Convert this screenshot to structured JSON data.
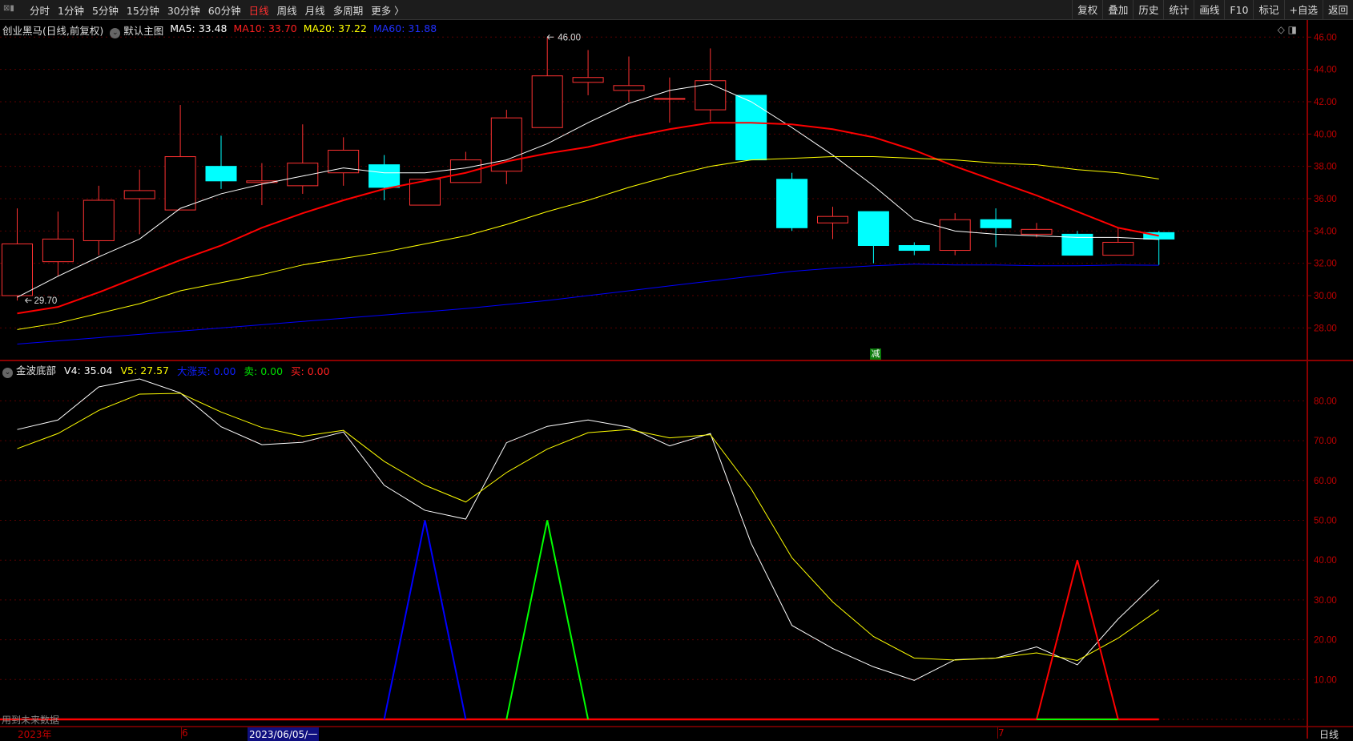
{
  "toolbar": {
    "tabs": [
      "分时",
      "1分钟",
      "5分钟",
      "15分钟",
      "30分钟",
      "60分钟",
      "日线",
      "周线",
      "月线",
      "多周期",
      "更多 〉"
    ],
    "active": "日线",
    "right": [
      "复权",
      "叠加",
      "历史",
      "统计",
      "画线",
      "F10",
      "标记",
      "+自选",
      "返回"
    ]
  },
  "legend": {
    "title": "创业黑马(日线,前复权)",
    "main": "默认主图",
    "ma5": "MA5: 33.48",
    "ma10": "MA10: 33.70",
    "ma20": "MA20: 37.22",
    "ma60": "MA60: 31.88"
  },
  "indicator": {
    "name": "金波底部",
    "v4": "V4: 35.04",
    "v5": "V5: 27.57",
    "dzm": "大涨买: 0.00",
    "sell": "卖: 0.00",
    "buy": "买: 0.00"
  },
  "colors": {
    "up": "#ff3232",
    "down": "#00ffff",
    "ma5": "#ffffff",
    "ma10": "#ff0000",
    "ma20": "#ffff00",
    "ma60": "#0000ff"
  },
  "markers": {
    "high": "46.00",
    "low": "29.70",
    "reduce": "减"
  },
  "future_note": "用到未来数据",
  "bottom_axis": {
    "year": "2023年",
    "m6": "6",
    "cursor": "2023/06/05/一",
    "m7": "7",
    "period": "日线"
  },
  "chart_data": [
    {
      "type": "candlestick",
      "ylim": [
        27,
        47
      ],
      "yticks": [
        "46.00",
        "44.00",
        "42.00",
        "40.00",
        "38.00",
        "36.00",
        "34.00",
        "32.00",
        "30.00",
        "28.00"
      ],
      "ohlc": [
        [
          30.0,
          35.4,
          29.7,
          33.2
        ],
        [
          32.1,
          35.2,
          31.2,
          33.5
        ],
        [
          33.4,
          36.8,
          32.5,
          35.9
        ],
        [
          36.0,
          37.8,
          33.8,
          36.5
        ],
        [
          35.3,
          41.8,
          35.3,
          38.6
        ],
        [
          38.0,
          39.9,
          36.6,
          37.1
        ],
        [
          37.0,
          38.2,
          35.6,
          37.1
        ],
        [
          36.8,
          40.6,
          36.3,
          38.2
        ],
        [
          37.6,
          39.8,
          36.8,
          39.0
        ],
        [
          38.1,
          38.7,
          35.9,
          36.7
        ],
        [
          35.6,
          37.2,
          35.6,
          37.2
        ],
        [
          37.0,
          38.9,
          37.0,
          38.4
        ],
        [
          37.7,
          41.5,
          36.9,
          41.0
        ],
        [
          40.4,
          46.0,
          40.4,
          43.6
        ],
        [
          43.2,
          45.2,
          42.4,
          43.5
        ],
        [
          42.7,
          44.8,
          42.0,
          43.0
        ],
        [
          42.2,
          43.5,
          40.7,
          42.2
        ],
        [
          41.5,
          45.3,
          40.8,
          43.3
        ],
        [
          42.4,
          42.4,
          38.4,
          38.4
        ],
        [
          37.2,
          37.6,
          34.0,
          34.2
        ],
        [
          34.5,
          35.5,
          33.5,
          34.9
        ],
        [
          35.2,
          35.2,
          32.0,
          33.1
        ],
        [
          33.1,
          33.3,
          32.5,
          32.8
        ],
        [
          32.8,
          35.1,
          32.5,
          34.7
        ],
        [
          34.7,
          35.4,
          33.0,
          34.2
        ],
        [
          33.8,
          34.5,
          33.6,
          34.1
        ],
        [
          33.8,
          34.0,
          32.5,
          32.5
        ],
        [
          32.5,
          34.2,
          32.5,
          33.3
        ],
        [
          33.9,
          34.0,
          31.9,
          33.5
        ]
      ],
      "series": [
        {
          "name": "MA5",
          "values": [
            29.9,
            31.2,
            32.4,
            33.5,
            35.4,
            36.3,
            36.9,
            37.4,
            37.9,
            37.6,
            37.6,
            37.9,
            38.4,
            39.4,
            40.7,
            41.9,
            42.7,
            43.1,
            42.0,
            40.4,
            38.7,
            36.8,
            34.7,
            34.0,
            33.8,
            33.7,
            33.6,
            33.6,
            33.48
          ]
        },
        {
          "name": "MA10",
          "values": [
            28.9,
            29.3,
            30.2,
            31.2,
            32.2,
            33.1,
            34.2,
            35.1,
            35.9,
            36.6,
            37.1,
            37.6,
            38.3,
            38.8,
            39.2,
            39.8,
            40.3,
            40.7,
            40.7,
            40.6,
            40.3,
            39.8,
            39.0,
            38.0,
            37.1,
            36.2,
            35.2,
            34.2,
            33.7
          ]
        },
        {
          "name": "MA20",
          "values": [
            27.9,
            28.3,
            28.9,
            29.5,
            30.3,
            30.8,
            31.3,
            31.9,
            32.3,
            32.7,
            33.2,
            33.7,
            34.4,
            35.2,
            35.9,
            36.7,
            37.4,
            38.0,
            38.4,
            38.5,
            38.6,
            38.6,
            38.5,
            38.4,
            38.2,
            38.1,
            37.8,
            37.6,
            37.22
          ]
        },
        {
          "name": "MA60",
          "values": [
            27.0,
            27.2,
            27.4,
            27.6,
            27.8,
            28.0,
            28.2,
            28.4,
            28.6,
            28.8,
            29.0,
            29.2,
            29.45,
            29.7,
            30.0,
            30.3,
            30.6,
            30.9,
            31.2,
            31.5,
            31.7,
            31.85,
            31.95,
            31.9,
            31.9,
            31.85,
            31.85,
            31.9,
            31.88
          ]
        }
      ]
    },
    {
      "type": "line",
      "title": "金波底部",
      "ylim": [
        0,
        88
      ],
      "yticks": [
        "80.00",
        "70.00",
        "60.00",
        "50.00",
        "40.00",
        "30.00",
        "20.00",
        "10.00"
      ],
      "series": [
        {
          "name": "V4",
          "values": [
            72.8,
            75.2,
            83.5,
            85.5,
            82,
            73.5,
            69,
            69.6,
            72.2,
            58.8,
            52.5,
            50.3,
            69.5,
            73.6,
            75.2,
            73.4,
            68.7,
            71.8,
            44.2,
            23.6,
            17.8,
            13.2,
            9.8,
            15,
            15.4,
            18.2,
            13.7,
            25.2,
            35.04
          ]
        },
        {
          "name": "V5",
          "values": [
            68,
            71.8,
            77.6,
            81.7,
            81.9,
            77.2,
            73.3,
            71.1,
            72.6,
            64.8,
            58.8,
            54.6,
            62,
            67.9,
            72,
            72.8,
            70.7,
            71.5,
            57.9,
            40.6,
            29.5,
            20.8,
            15.4,
            14.9,
            15.4,
            16.7,
            14.8,
            20.4,
            27.57
          ]
        },
        {
          "name": "大涨买",
          "values": [
            0,
            0,
            0,
            0,
            0,
            0,
            0,
            0,
            0,
            0,
            50,
            0,
            0,
            0,
            0,
            0,
            0,
            0,
            0,
            0,
            0,
            0,
            0,
            0,
            0,
            0,
            0,
            0,
            0
          ]
        },
        {
          "name": "卖",
          "values": [
            0,
            0,
            0,
            0,
            0,
            0,
            0,
            0,
            0,
            0,
            0,
            0,
            0,
            50,
            0,
            0,
            0,
            0,
            0,
            0,
            0,
            0,
            0,
            0,
            0,
            0,
            0,
            0,
            0
          ]
        },
        {
          "name": "买",
          "values": [
            0,
            0,
            0,
            0,
            0,
            0,
            0,
            0,
            0,
            0,
            0,
            0,
            0,
            0,
            0,
            0,
            0,
            0,
            0,
            0,
            0,
            0,
            0,
            0,
            0,
            0,
            40,
            0,
            0
          ]
        }
      ]
    }
  ]
}
